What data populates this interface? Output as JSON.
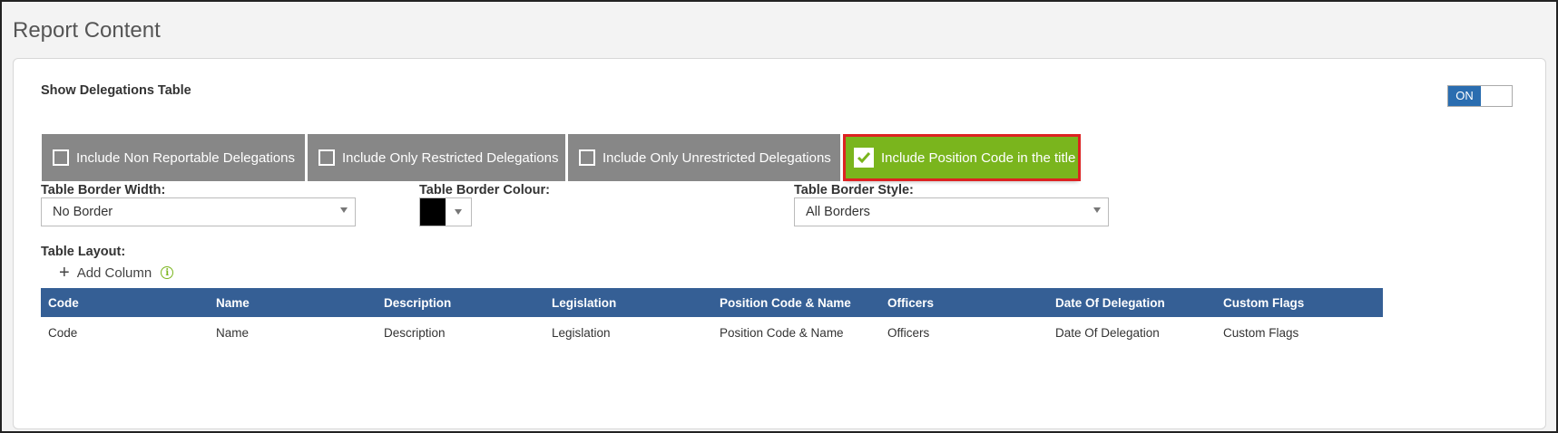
{
  "page": {
    "title": "Report Content"
  },
  "delegations": {
    "label": "Show Delegations Table",
    "toggle_label": "ON"
  },
  "options": [
    {
      "label": "Include Non Reportable Delegations",
      "checked": false
    },
    {
      "label": "Include Only Restricted Delegations",
      "checked": false
    },
    {
      "label": "Include Only Unrestricted Delegations",
      "checked": false
    },
    {
      "label": "Include Position Code in the title",
      "checked": true
    }
  ],
  "border_width": {
    "label": "Table Border Width:",
    "value": "No Border"
  },
  "border_colour": {
    "label": "Table Border Colour:",
    "value": "#000000"
  },
  "border_style": {
    "label": "Table Border Style:",
    "value": "All Borders"
  },
  "layout": {
    "label": "Table Layout:",
    "add_column_label": "Add Column",
    "columns": [
      "Code",
      "Name",
      "Description",
      "Legislation",
      "Position Code & Name",
      "Officers",
      "Date Of Delegation",
      "Custom Flags"
    ],
    "row": [
      "Code",
      "Name",
      "Description",
      "Legislation",
      "Position Code & Name",
      "Officers",
      "Date Of Delegation",
      "Custom Flags"
    ]
  },
  "colors": {
    "accent_blue": "#2a6db0",
    "header_blue": "#355f95",
    "checked_green": "#7ab51d",
    "option_grey": "#878787",
    "highlight_red": "#dd2222"
  }
}
